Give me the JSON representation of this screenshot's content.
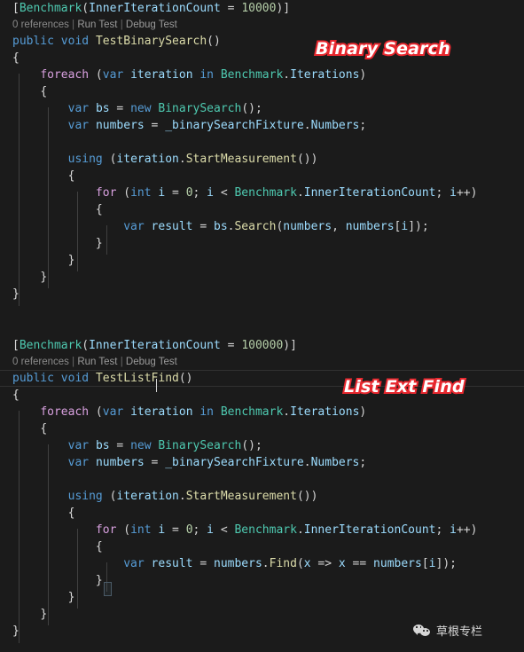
{
  "editor": {
    "theme": "vscode-dark",
    "background": "#1b1b1b",
    "font_size_px": 13,
    "colors": {
      "foreground": "#d4d4d4",
      "keyword": "#569cd6",
      "control_keyword": "#d8a0df",
      "type": "#4ec9b0",
      "method": "#dcdcaa",
      "variable": "#9cdcfe",
      "number": "#b5cea8",
      "codelens": "#888888",
      "indent_guide": "#404040",
      "annotation_red": "#e8282f"
    }
  },
  "blocks": [
    {
      "id": "binary-search-benchmark",
      "attribute": {
        "open_bracket": "[",
        "name": "Benchmark",
        "paren_open": "(",
        "arg_name": "InnerIterationCount",
        "equals": " = ",
        "arg_value": "10000",
        "paren_close": ")",
        "close_bracket": "]"
      },
      "codelens": {
        "references": "0 references",
        "sep1": " | ",
        "run_test": "Run Test",
        "sep2": " | ",
        "debug_test": "Debug Test"
      },
      "signature": {
        "modifier": "public",
        "return_type": "void",
        "method_name": "TestBinarySearch",
        "parens": "()"
      },
      "annotation": "Binary Search",
      "body_lines": [
        "{",
        "    foreach (var iteration in Benchmark.Iterations)",
        "    {",
        "        var bs = new BinarySearch();",
        "        var numbers = _binarySearchFixture.Numbers;",
        "",
        "        using (iteration.StartMeasurement())",
        "        {",
        "            for (int i = 0; i < Benchmark.InnerIterationCount; i++)",
        "            {",
        "                var result = bs.Search(numbers, numbers[i]);",
        "            }",
        "        }",
        "    }",
        "}"
      ]
    },
    {
      "id": "list-ext-find-benchmark",
      "attribute": {
        "open_bracket": "[",
        "name": "Benchmark",
        "paren_open": "(",
        "arg_name": "InnerIterationCount",
        "equals": " = ",
        "arg_value": "100000",
        "paren_close": ")",
        "close_bracket": "]"
      },
      "codelens": {
        "references": "0 references",
        "sep1": " | ",
        "run_test": "Run Test",
        "sep2": " | ",
        "debug_test": "Debug Test"
      },
      "signature": {
        "modifier": "public",
        "return_type": "void",
        "method_name": "TestListFind",
        "parens": "()",
        "caret_after": "TestList"
      },
      "annotation": "List Ext Find",
      "body_lines": [
        "{",
        "    foreach (var iteration in Benchmark.Iterations)",
        "    {",
        "        var bs = new BinarySearch();",
        "        var numbers = _binarySearchFixture.Numbers;",
        "",
        "        using (iteration.StartMeasurement())",
        "        {",
        "            for (int i = 0; i < Benchmark.InnerIterationCount; i++)",
        "            {",
        "                var result = numbers.Find(x => x == numbers[i]);",
        "            }",
        "        }",
        "    }",
        "}"
      ]
    }
  ],
  "watermark": {
    "icon": "wechat-icon",
    "label": "草根专栏"
  }
}
